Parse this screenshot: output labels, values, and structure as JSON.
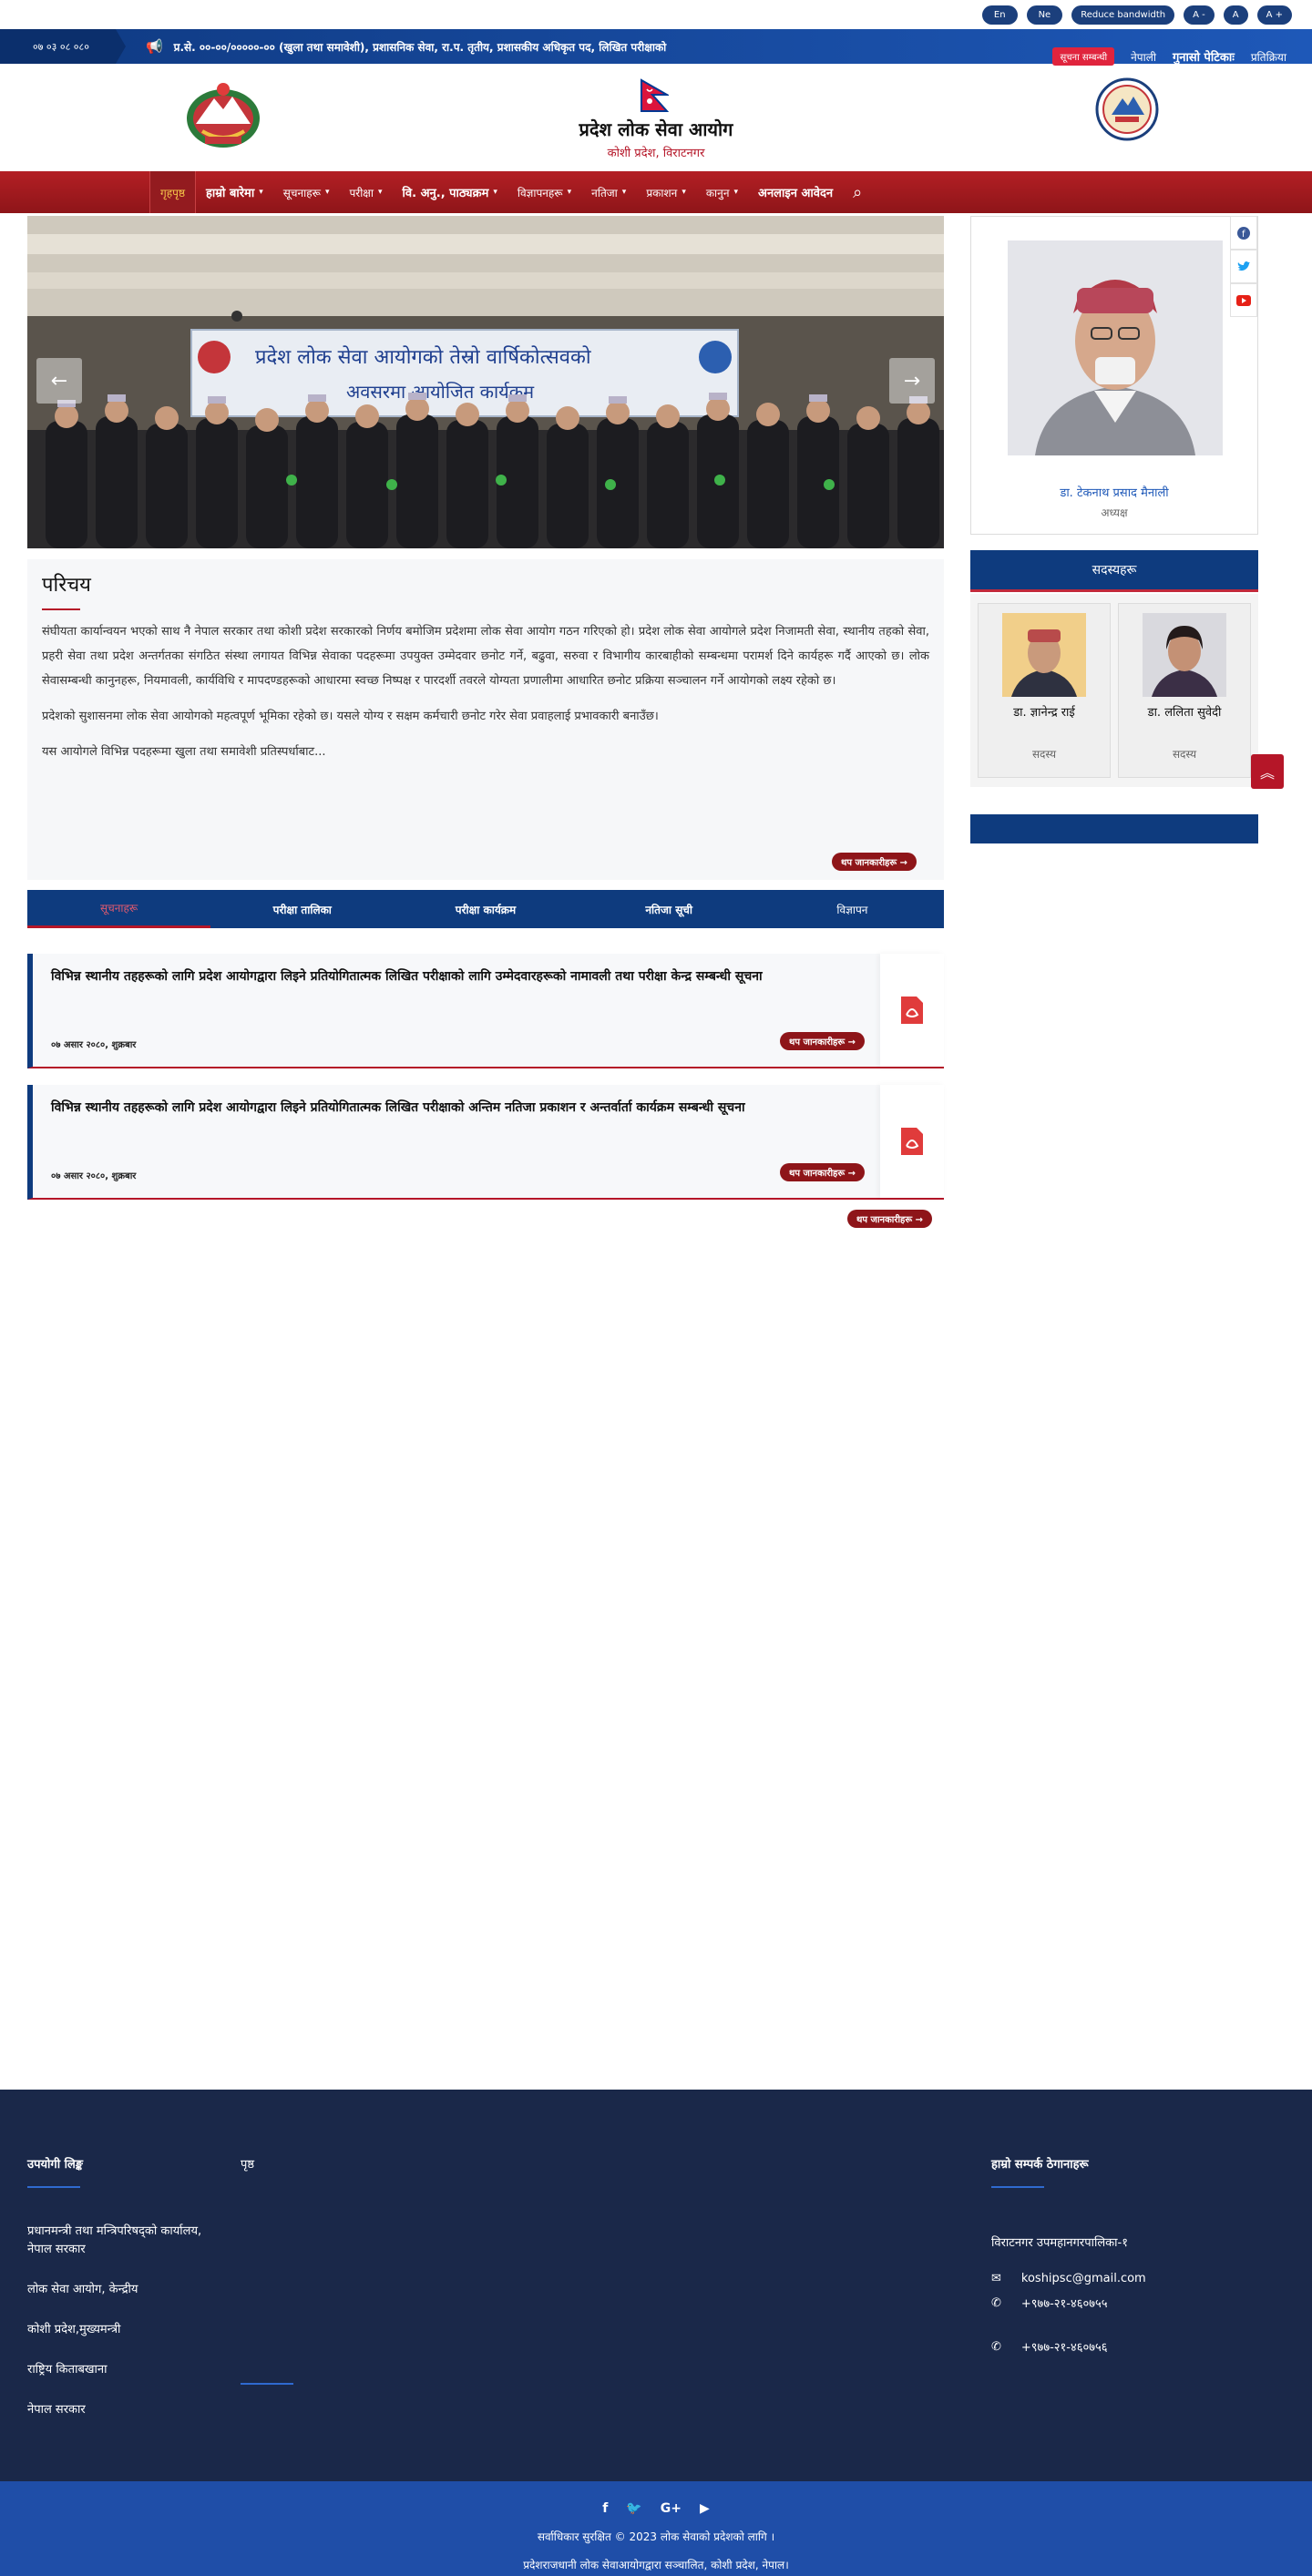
{
  "utility": {
    "lang_en": "En",
    "lang_ne": "Ne",
    "bandwidth": "Reduce bandwidth",
    "font_minus": "A -",
    "font_normal": "A",
    "font_plus": "A +"
  },
  "ticker": {
    "date": "०७ ०३  ०८ ०८०",
    "headline": "प्र.से. ००-००/०००००-०० (खुला तथा समावेशी), प्रशासनिक सेवा, रा.प. तृतीय, प्रशासकीय अधिकृत पद, लिखित परीक्षाको",
    "badge": "सूचना सम्बन्धी",
    "link1": "नेपाली",
    "link2": "गुनासो पेटिकाः",
    "link3": "प्रतिक्रिया"
  },
  "header": {
    "title": "प्रदेश लोक सेवा आयोग",
    "subtitle": "कोशी प्रदेश, विराटनगर"
  },
  "nav": {
    "items": [
      {
        "label": "गृहपृष्ठ",
        "chev": false
      },
      {
        "label": "हाम्रो बारेमा",
        "chev": true
      },
      {
        "label": "सूचनाहरू",
        "chev": true
      },
      {
        "label": "परीक्षा",
        "chev": true
      },
      {
        "label": "वि. अनु., पाठ्यक्रम",
        "chev": true
      },
      {
        "label": "विज्ञापनहरू",
        "chev": true
      },
      {
        "label": "नतिजा",
        "chev": true
      },
      {
        "label": "प्रकाशन",
        "chev": true
      },
      {
        "label": "कानुन",
        "chev": true
      },
      {
        "label": "अनलाइन आवेदन",
        "chev": false
      }
    ]
  },
  "slider": {
    "banner_text": "प्रदेश लोक सेवा आयोगको तेस्रो वार्षिकोत्सवको",
    "banner_text2": "अवसरमा आयोजित कार्यक्रम"
  },
  "about": {
    "heading": "परिचय",
    "p1": "संघीयता कार्यान्वयन भएको साथ  नै नेपाल सरकार तथा कोशी प्रदेश सरकारको निर्णय बमोजिम प्रदेशमा लोक सेवा आयोग गठन गरिएको हो। प्रदेश लोक सेवा आयोगले प्रदेश निजामती सेवा, स्थानीय तहको सेवा, प्रहरी सेवा तथा प्रदेश अन्तर्गतका संगठित संस्था लगायत विभिन्न सेवाका पदहरूमा उपयुक्त उम्मेदवार छनोट गर्ने, बढुवा, सरुवा र विभागीय कारबाहीको सम्बन्धमा परामर्श दिने कार्यहरू गर्दै आएको छ। लोक सेवासम्बन्धी कानुनहरू, नियमावली, कार्यविधि र मापदण्डहरूको आधारमा स्वच्छ निष्पक्ष र पारदर्शी तवरले योग्यता प्रणालीमा आधारित छनोट प्रक्रिया सञ्चालन गर्ने आयोगको लक्ष्य रहेको छ।",
    "p2": "प्रदेशको सुशासनमा लोक सेवा आयोगको महत्वपूर्ण भूमिका रहेको छ। यसले योग्य र सक्षम कर्मचारी छनोट गरेर सेवा प्रवाहलाई प्रभावकारी बनाउँछ।",
    "p3": "यस आयोगले विभिन्न पदहरूमा खुला तथा समावेशी प्रतिस्पर्धाबाट...",
    "more": "थप जानकारीहरू"
  },
  "tabs": [
    {
      "label": "सूचनाहरू"
    },
    {
      "label": "परीक्षा तालिका"
    },
    {
      "label": "परीक्षा कार्यक्रम"
    },
    {
      "label": "नतिजा सूची"
    },
    {
      "label": "विज्ञापन"
    }
  ],
  "notices": [
    {
      "title": "विभिन्न स्थानीय तहहरूको लागि प्रदेश आयोगद्वारा लिइने प्रतियोगितात्मक लिखित परीक्षाको लागि उम्मेदवारहरूको नामावली तथा परीक्षा केन्द्र सम्बन्धी सूचना",
      "meta": "०७ असार २०८०, शुक्रबार",
      "button": "थप जानकारीहरू"
    },
    {
      "title": "विभिन्न स्थानीय तहहरूको लागि प्रदेश आयोगद्वारा लिइने प्रतियोगितात्मक लिखित परीक्षाको अन्तिम नतिजा प्रकाशन र अन्तर्वार्ता कार्यक्रम सम्बन्धी सूचना",
      "meta": "०७ असार २०८०, शुक्रबार",
      "button": "थप जानकारीहरू"
    }
  ],
  "notices_more": "थप जानकारीहरू",
  "chief": {
    "name": "डा. टेकनाथ प्रसाद मैनाली",
    "role": "अध्यक्ष"
  },
  "members": {
    "heading": "सदस्यहरू",
    "items": [
      {
        "name": "डा. ज्ञानेन्द्र राई",
        "role": "सदस्य"
      },
      {
        "name": "डा. ललिता सुवेदी",
        "role": "सदस्य"
      }
    ]
  },
  "footer": {
    "col1_title": "उपयोगी लिङ्क",
    "links": [
      "प्रधानमन्त्री तथा मन्त्रिपरिषद्को कार्यालय, नेपाल सरकार",
      "लोक सेवा आयोग, केन्द्रीय",
      "कोशी प्रदेश,मुख्यमन्त्री",
      "राष्ट्रिय किताबखाना",
      "नेपाल सरकार"
    ],
    "col2_title": "पृष्ठ",
    "col3_title": "हाम्रो सम्पर्क ठेगानाहरू",
    "address": "विराटनगर उपमहानगरपालिका-१",
    "email": "koshipsc@gmail.com",
    "phone1": "+९७७-२१-४६०७५५",
    "phone2": "+९७७-२१-४६०७५६"
  },
  "bottom": {
    "line1": "सर्वाधिकार सुरक्षित © 2023 लोक सेवाको प्रदेशको लागि ।",
    "line2": "प्रदेशराजधानी लोक सेवाआयोगद्वारा सञ्चालित, कोशी प्रदेश, नेपाल।"
  },
  "colors": {
    "navy": "#0e3b7e",
    "red": "#b51628",
    "footer": "#1a2849"
  }
}
